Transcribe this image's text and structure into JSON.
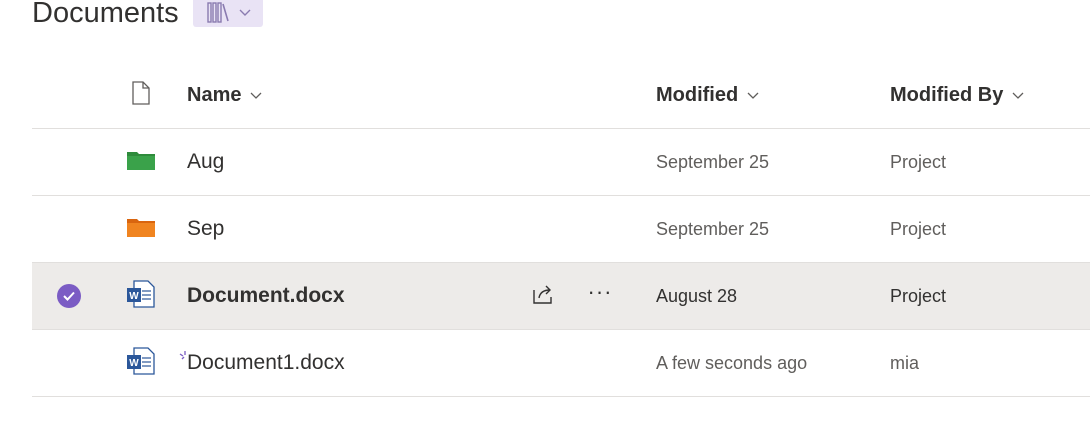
{
  "page": {
    "title": "Documents",
    "view_switch_icon": "library-icon"
  },
  "columns": {
    "type_icon": "document-icon",
    "name": "Name",
    "modified": "Modified",
    "modified_by": "Modified By"
  },
  "rows": [
    {
      "type": "folder",
      "icon": "folder-icon",
      "color": "#2e8b3b",
      "name": "Aug",
      "modified": "September 25",
      "modified_by": "Project",
      "selected": false
    },
    {
      "type": "folder",
      "icon": "folder-icon",
      "color": "#e8741a",
      "name": "Sep",
      "modified": "September 25",
      "modified_by": "Project",
      "selected": false
    },
    {
      "type": "word",
      "icon": "word-document-icon",
      "color": "#2b579a",
      "name": "Document.docx",
      "modified": "August 28",
      "modified_by": "Project",
      "selected": true
    },
    {
      "type": "word",
      "icon": "word-document-icon",
      "color": "#2b579a",
      "name": "Document1.docx",
      "modified": "A few seconds ago",
      "modified_by": "mia",
      "selected": false,
      "new": true
    }
  ],
  "colors": {
    "accent": "#7b5cc4",
    "selected_row": "#edebe9",
    "divider": "#e1dfdd"
  }
}
